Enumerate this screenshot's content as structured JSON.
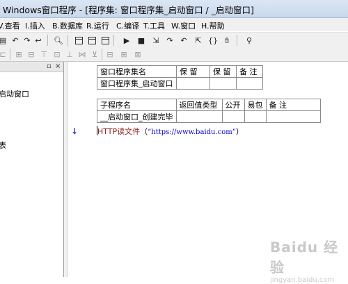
{
  "window": {
    "title": "Windows窗口程序 - [程序集: 窗口程序集_启动窗口 / _启动窗口]"
  },
  "menu": [
    {
      "label": "V.查看"
    },
    {
      "label": "I.插入"
    },
    {
      "label": "B.数据库"
    },
    {
      "label": "R.运行"
    },
    {
      "label": "C.编译"
    },
    {
      "label": "T.工具"
    },
    {
      "label": "W.窗口"
    },
    {
      "label": "H.帮助"
    }
  ],
  "panel": {
    "controls": {
      "pin": "▫",
      "close": "×"
    },
    "items": [
      {
        "label": "启动窗口"
      },
      {
        "label": "表"
      }
    ]
  },
  "assembly_table": {
    "headers": [
      "窗口程序集名",
      "保 留",
      "保 留",
      "备 注"
    ],
    "row": [
      "窗口程序集_启动窗口",
      "",
      "",
      ""
    ]
  },
  "sub_table": {
    "headers": [
      "子程序名",
      "返回值类型",
      "公开",
      "易包",
      "备 注"
    ],
    "row": [
      "__启动窗口_创建完毕",
      "",
      "",
      "",
      ""
    ]
  },
  "code": {
    "command": "HTTP读文件",
    "open_paren": "（",
    "argument": "“https://www.baidu.com”",
    "close_paren": "）"
  },
  "watermark": {
    "brand": "Baidu 经验",
    "url": "jingyan.baidu.com"
  }
}
